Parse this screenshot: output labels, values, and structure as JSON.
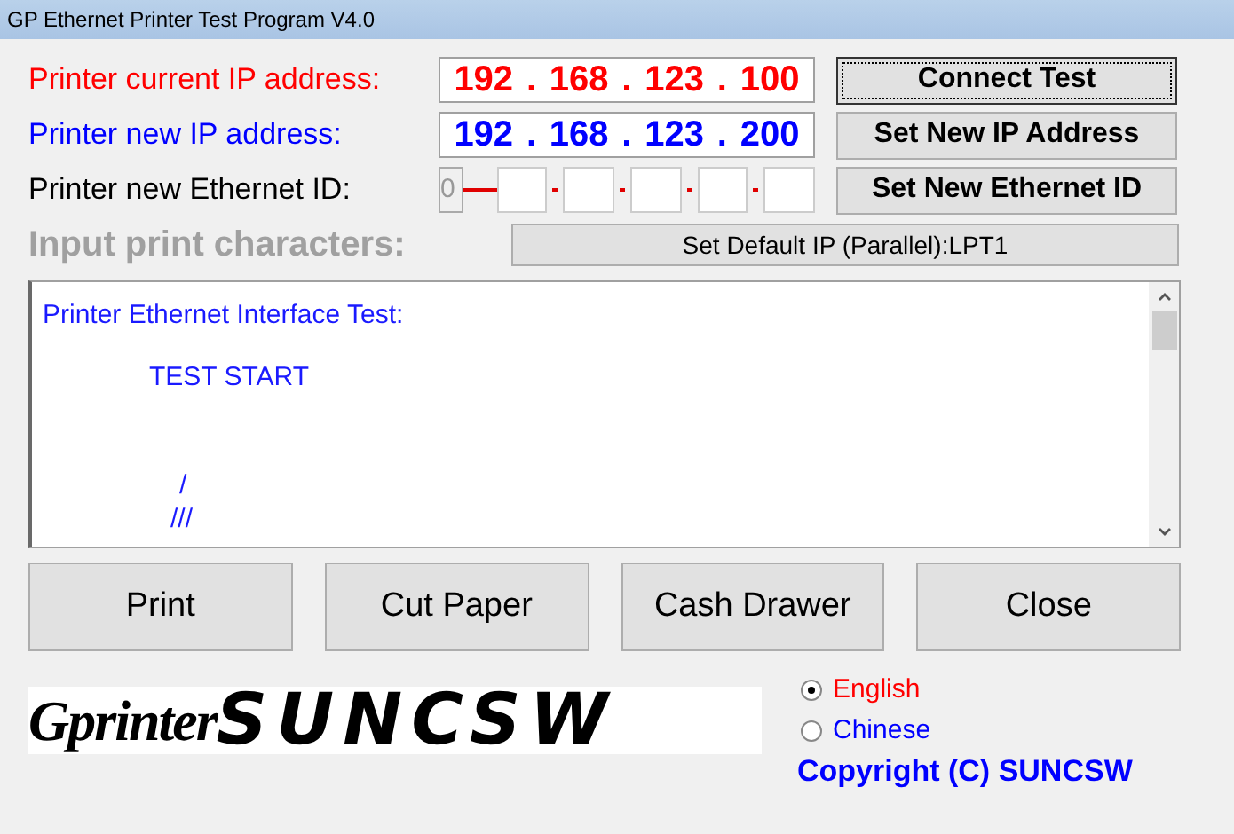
{
  "window": {
    "title": "GP Ethernet Printer Test Program  V4.0"
  },
  "current_ip": {
    "label": "Printer current IP address:",
    "octets": [
      "192",
      "168",
      "123",
      "100"
    ],
    "separator": ".",
    "button": "Connect Test"
  },
  "new_ip": {
    "label": "Printer new IP address:",
    "octets": [
      "192",
      "168",
      "123",
      "200"
    ],
    "separator": ".",
    "button": "Set New IP Address"
  },
  "ethernet_id": {
    "label": "Printer new Ethernet ID:",
    "fields": [
      {
        "kind": "digit",
        "value": "0"
      },
      {
        "kind": "blank"
      },
      {
        "kind": "blank"
      },
      {
        "kind": "blank"
      },
      {
        "kind": "blank"
      },
      {
        "kind": "blank"
      }
    ],
    "button": "Set New Ethernet ID"
  },
  "input_print": {
    "label": "Input print characters:",
    "disabled": true,
    "button": "Set Default IP (Parallel):LPT1"
  },
  "output": {
    "lines": [
      {
        "kind": "heading",
        "text": "Printer Ethernet Interface Test:"
      },
      {
        "kind": "status",
        "text": "TEST  START"
      },
      {
        "kind": "mark",
        "text": "/"
      },
      {
        "kind": "mark",
        "text": "///"
      }
    ]
  },
  "buttons": [
    "Print",
    "Cut Paper",
    "Cash Drawer",
    "Close"
  ],
  "logo": {
    "part1": "Gprinter",
    "part2": "SUNCSW"
  },
  "languages": [
    {
      "label": "English",
      "selected": true,
      "color": "#ff0000"
    },
    {
      "label": "Chinese",
      "selected": false,
      "color": "#0000ff"
    }
  ],
  "copyright": "Copyright (C) SUNCSW"
}
